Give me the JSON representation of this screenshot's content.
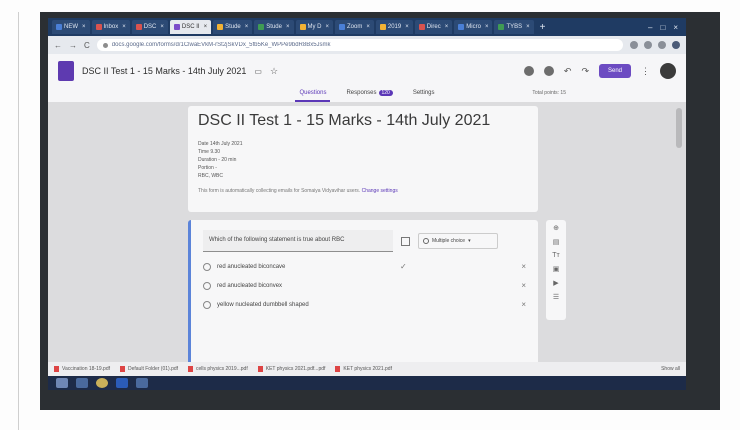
{
  "browser": {
    "tabs": [
      {
        "label": "NEW"
      },
      {
        "label": "Inbox"
      },
      {
        "label": "DSC"
      },
      {
        "label": "DSC II"
      },
      {
        "label": "Stude"
      },
      {
        "label": "Stude"
      },
      {
        "label": "My D"
      },
      {
        "label": "Zoom"
      },
      {
        "label": "2019"
      },
      {
        "label": "Direc"
      },
      {
        "label": "Micro"
      },
      {
        "label": "TYBS"
      }
    ],
    "url": "docs.google.com/forms/d/1ClwaEVkM-rSt2jSkVDx_5fb5Ke_WPPe9bdR8Bx5Jsmk"
  },
  "header": {
    "title": "DSC II Test 1 - 15 Marks - 14th July 2021",
    "send_label": "Send"
  },
  "subtabs": {
    "questions": "Questions",
    "responses": "Responses",
    "responses_count": "120",
    "settings": "Settings",
    "total_points": "Total points: 15"
  },
  "form": {
    "heading": "DSC II Test 1 - 15 Marks - 14th July 2021",
    "description_lines": [
      "Date 14th July 2021",
      "Time 9.30",
      "Duration - 20 min",
      "Portion -",
      "RBC, WBC"
    ],
    "notice": "This form is automatically collecting emails for Somaiya Vidyavihar users.",
    "notice_link": "Change settings"
  },
  "question": {
    "text": "Which of the following statement is true about RBC",
    "type": "Multiple choice",
    "options": [
      "red anucleated biconcave",
      "red anucleated biconvex",
      "yellow nucleated dumbbell shaped"
    ]
  },
  "downloads": {
    "items": [
      "Vaccination 18-19.pdf",
      "Default Folder (01).pdf",
      "cells physics 2019...pdf",
      "KET physics 2021.pdf...pdf",
      "KET physics 2021.pdf"
    ],
    "show_all": "Show all"
  },
  "colors": {
    "accent": "#673ab7",
    "tab_strip": "#1f3b63"
  }
}
